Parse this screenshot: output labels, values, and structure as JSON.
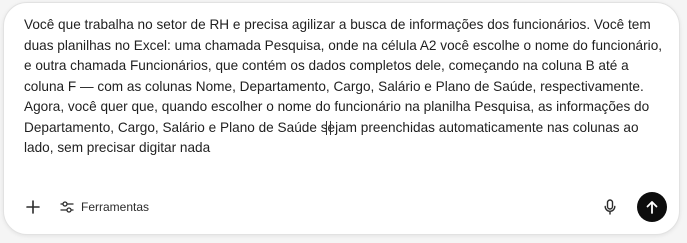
{
  "composer": {
    "paragraphs": [
      "Você que trabalha no setor de RH e precisa agilizar a busca de informações dos funcionários. Você tem duas planilhas no Excel: uma chamada Pesquisa, onde na célula A2 você escolhe o nome do funcionário, e outra chamada Funcionários, que contém os dados completos dele, começando na coluna B até a coluna F — com as colunas Nome, Departamento, Cargo, Salário e Plano de Saúde, respectivamente.",
      "Agora, você quer que, quando escolher o nome do funcionário na planilha Pesquisa, as informações do Departamento, Cargo, Salário e Plano de Saúde sejam preenchidas automaticamente nas colunas ao lado, sem precisar digitar nada"
    ]
  },
  "toolbar": {
    "add_icon": "plus-icon",
    "tools_icon": "sliders-icon",
    "tools_label": "Ferramentas",
    "mic_icon": "microphone-icon",
    "send_icon": "arrow-up-icon"
  },
  "colors": {
    "send_button": "#0d0d0d",
    "text": "#1f1f1f",
    "border": "#e2e2e2"
  }
}
